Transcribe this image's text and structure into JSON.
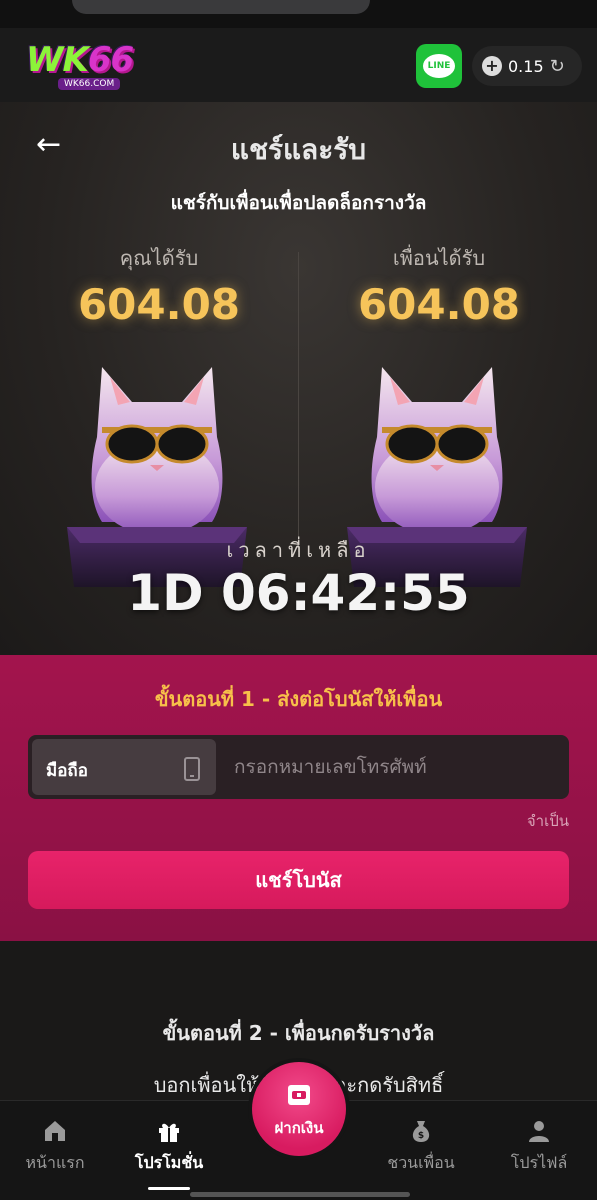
{
  "header": {
    "logo_main": "WK",
    "logo_num": "66",
    "logo_sub": "WK66.COM",
    "line_label": "LINE",
    "balance": "0.15",
    "icons": [
      "plus-icon",
      "refresh-icon",
      "line-icon"
    ]
  },
  "page": {
    "title": "แชร์และรับ",
    "subtitle": "แชร์กับเพื่อนเพื่อปลดล็อกรางวัล"
  },
  "reward": {
    "you_label": "คุณได้รับ",
    "you_amount": "604.08",
    "friend_label": "เพื่อนได้รับ",
    "friend_amount": "604.08"
  },
  "timer": {
    "label": "เวลาที่เหลือ",
    "value": "1D 06:42:55"
  },
  "step1": {
    "title": "ขั้นตอนที่ 1 - ส่งต่อโบนัสให้เพื่อน",
    "phone_tag": "มือถือ",
    "phone_placeholder": "กรอกหมายเลขโทรศัพท์",
    "required_label": "จำเป็น",
    "share_button": "แชร์โบนัส"
  },
  "step2": {
    "title": "ขั้นตอนที่ 2 - เพื่อนกดรับรางวัล",
    "desc": "บอกเพื่อนให้ล็อกอินและกดรับสิทธิ์"
  },
  "nav": {
    "home": "หน้าแรก",
    "promotions": "โปรโมชั่น",
    "deposit": "ฝากเงิน",
    "invite": "ชวนเพื่อน",
    "profile": "โปรไฟล์",
    "active": "promotions"
  },
  "colors": {
    "accent_gold": "#f6c45a",
    "accent_pink": "#d61a5c",
    "step1_bg": "#a3144d",
    "line_green": "#1fc23a"
  }
}
